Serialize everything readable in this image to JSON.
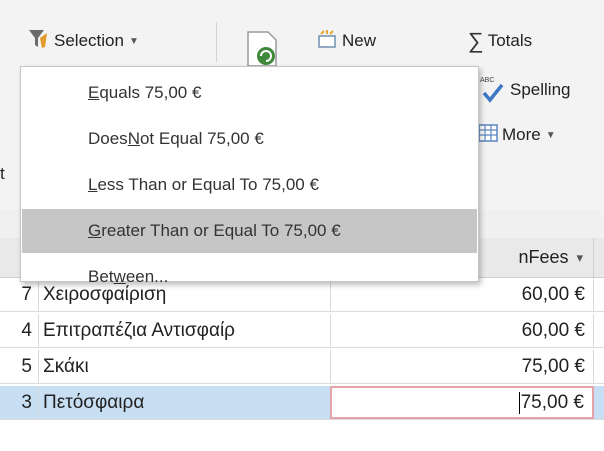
{
  "ribbon": {
    "selection_label": "Selection",
    "new_label": "New",
    "totals_label": "Totals",
    "spelling_label": "Spelling",
    "more_label": "More",
    "spelling_icon_text": "ABC"
  },
  "menu": {
    "items": [
      {
        "pre": "",
        "accel": "E",
        "post": "quals 75,00 €"
      },
      {
        "pre": "Does ",
        "accel": "N",
        "post": "ot Equal 75,00 €"
      },
      {
        "pre": "",
        "accel": "L",
        "post": "ess Than or Equal To 75,00 €"
      },
      {
        "pre": "",
        "accel": "G",
        "post": "reater Than or Equal To 75,00 €"
      },
      {
        "pre": "Bet",
        "accel": "w",
        "post": "een..."
      }
    ],
    "highlighted_index": 3
  },
  "datasheet": {
    "fee_header": "nFees",
    "sort_icon": "sort-descending-icon",
    "rows": [
      {
        "id": "7",
        "name": "Χειροσφαίριση",
        "fee": "60,00 €"
      },
      {
        "id": "4",
        "name": "Επιτραπέζια Αντισφαίρ",
        "fee": "60,00 €"
      },
      {
        "id": "5",
        "name": "Σκάκι",
        "fee": "75,00 €"
      },
      {
        "id": "3",
        "name": "Πετόσφαιρα",
        "fee": "75,00 €"
      }
    ],
    "selected_row": 3
  },
  "colors": {
    "menu_highlight": "#c6c6c6",
    "selected_row": "#c7def3",
    "active_cell_border": "#e3a3a8"
  }
}
